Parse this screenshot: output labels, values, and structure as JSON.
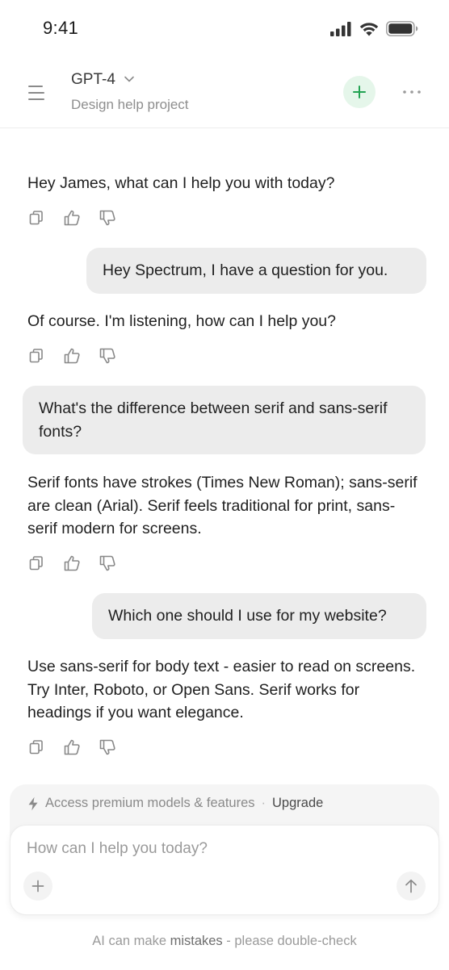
{
  "status_bar": {
    "time": "9:41",
    "icons": [
      "cellular-signal-icon",
      "wifi-icon",
      "battery-icon"
    ]
  },
  "header": {
    "model_name": "GPT-4",
    "project_name": "Design help project",
    "icons": [
      "menu-icon",
      "chevron-down-icon",
      "plus-icon",
      "more-horizontal-icon"
    ],
    "accent_color": "#22a352",
    "accent_bg": "#e5f6ea"
  },
  "messages": [
    {
      "role": "assistant",
      "text": "Hey James, what can I help you with today?"
    },
    {
      "role": "user",
      "text": "Hey Spectrum, I have a question for you."
    },
    {
      "role": "assistant",
      "text": "Of course. I'm listening, how can I help you?"
    },
    {
      "role": "user",
      "text": "What's the difference between serif and sans-serif fonts?"
    },
    {
      "role": "assistant",
      "text": "Serif fonts have strokes (Times New Roman); sans-serif are clean (Arial). Serif feels traditional for print, sans-serif modern for screens."
    },
    {
      "role": "user",
      "text": "Which one should I use for my website?"
    },
    {
      "role": "assistant",
      "text": "Use sans-serif for body text - easier to read on screens. Try Inter, Roboto, or Open Sans. Serif works for headings if you want elegance."
    }
  ],
  "message_actions": [
    "copy-icon",
    "thumbs-up-icon",
    "thumbs-down-icon"
  ],
  "composer": {
    "upsell_text": "Access premium models & features",
    "upsell_separator": "·",
    "upgrade_label": "Upgrade",
    "placeholder": "How can I help you today?",
    "value": "",
    "icons": [
      "lightning-icon",
      "plus-icon",
      "arrow-up-icon"
    ]
  },
  "disclaimer": {
    "prefix": "AI can make ",
    "emphasis": "mistakes",
    "suffix": " - please double-check"
  }
}
